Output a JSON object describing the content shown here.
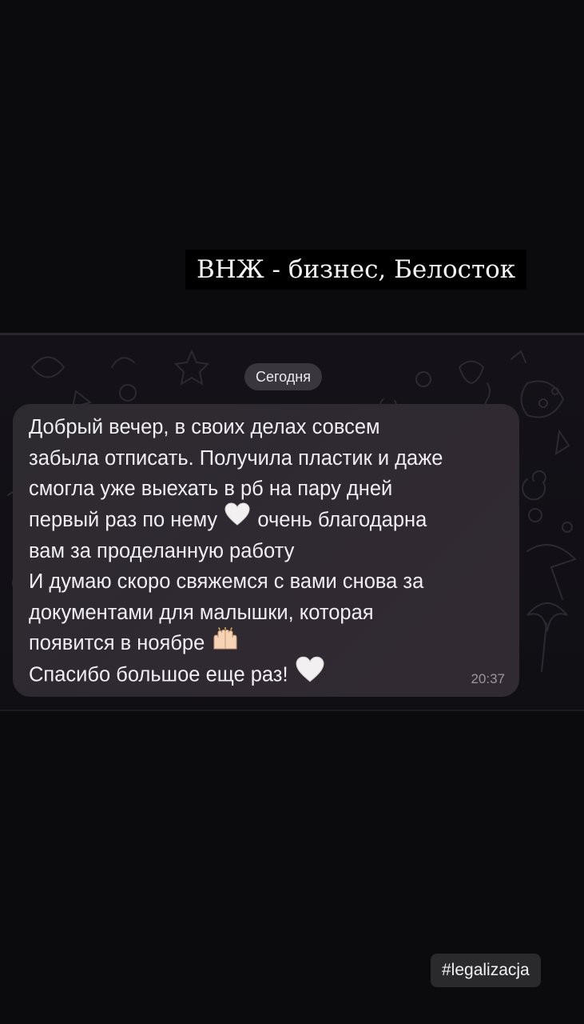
{
  "story": {
    "caption": "ВНЖ - бизнес, Белосток",
    "hashtag": "#legalizacja"
  },
  "chat": {
    "date_chip": "Сегодня",
    "message": {
      "lines": [
        [
          "Добрый вечер, в своих делах совсем"
        ],
        [
          "забыла отписать. Получила пластик и даже"
        ],
        [
          "смогла уже выехать в рб на пару дней"
        ],
        [
          "первый раз по нему",
          "очень благодарна"
        ],
        [
          "вам за проделанную работу"
        ],
        [
          "И думаю скоро свяжемся с вами снова за"
        ],
        [
          "документами для малышки, которая"
        ],
        [
          "появится в ноябре"
        ],
        [
          "Спасибо большое еще раз!"
        ]
      ],
      "icons": {
        "heart": "white-heart-icon",
        "hands": "raising-hands-icon"
      },
      "time": "20:37"
    }
  },
  "colors": {
    "background": "#0b0b0d",
    "bubble": "#2f2931",
    "text": "#f1eef3",
    "time": "#9a95a0"
  }
}
